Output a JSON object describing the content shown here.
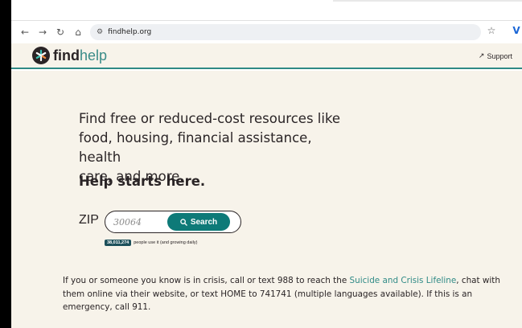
{
  "browser": {
    "url": "findhelp.org",
    "icons": [
      "back-icon",
      "forward-icon",
      "reload-icon",
      "home-icon",
      "site-settings-icon",
      "bookmark-star-icon",
      "extension-icon"
    ]
  },
  "header": {
    "logo_find": "find",
    "logo_help": "help",
    "support_label": "Support"
  },
  "hero": {
    "line1": "Find free or reduced-cost resources like",
    "line2": "food, housing, financial assistance, health",
    "line3": "care, and more.",
    "strong": "Help starts here."
  },
  "search": {
    "zip_label": "ZIP",
    "zip_placeholder": "30064",
    "button_label": "Search"
  },
  "stats": {
    "count": "38,011,274",
    "suffix": "people use it (and growing daily)"
  },
  "crisis": {
    "before_link": "If you or someone you know is in crisis, call or text 988 to reach the ",
    "link": "Suicide and Crisis Lifeline",
    "after_link": ", chat with them online via their website, or text HOME to 741741 (multiple languages available). If this is an emergency, call 911."
  },
  "colors": {
    "accent": "#0e7a78",
    "background": "#f7f3ea",
    "text": "#2a2426",
    "badge": "#1c4f5a"
  }
}
